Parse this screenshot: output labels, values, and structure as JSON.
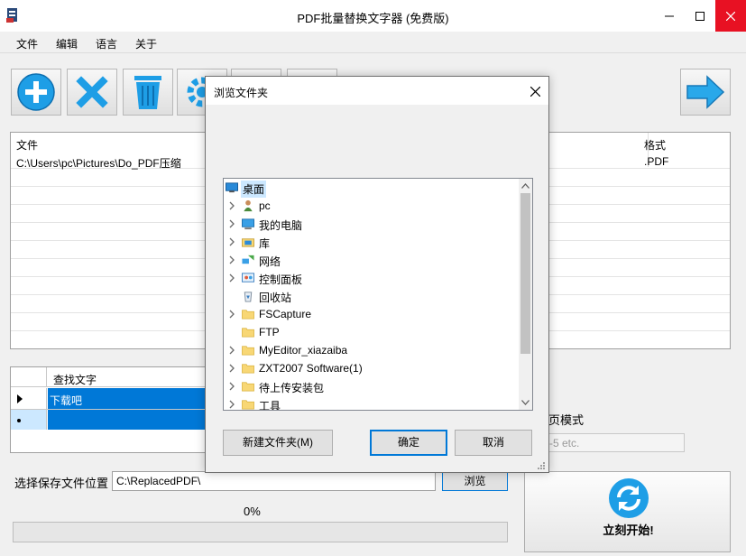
{
  "window": {
    "title": "PDF批量替换文字器 (免费版)"
  },
  "menu": [
    "文件",
    "编辑",
    "语言",
    "关于"
  ],
  "toolbar": {
    "buttons": [
      "add-icon",
      "remove-icon",
      "trash-icon",
      "settings-icon",
      "globe-icon",
      "info-icon",
      "next-arrow-icon"
    ]
  },
  "file_list": {
    "col_file": "文件",
    "col_format": "格式",
    "rows": [
      {
        "file": "C:\\Users\\pc\\Pictures\\Do_PDF压缩",
        "format": ".PDF"
      }
    ]
  },
  "grid": {
    "col_find": "查找文字",
    "rows": [
      {
        "value": "下载吧"
      },
      {
        "value": ""
      }
    ]
  },
  "right_panel": {
    "label": "页模式",
    "input_placeholder": "-5 etc."
  },
  "save": {
    "label": "选择保存文件位置",
    "path": "C:\\ReplacedPDF\\",
    "browse_label": "浏览"
  },
  "progress": {
    "text": "0%",
    "value": 0
  },
  "start_button": {
    "label": "立刻开始!"
  },
  "dialog": {
    "title": "浏览文件夹",
    "tree": [
      {
        "label": "桌面",
        "icon": "desktop-icon",
        "expandable": false,
        "selected": true,
        "level": 0
      },
      {
        "label": "pc",
        "icon": "user-icon",
        "expandable": true,
        "selected": false,
        "level": 1
      },
      {
        "label": "我的电脑",
        "icon": "computer-icon",
        "expandable": true,
        "selected": false,
        "level": 1
      },
      {
        "label": "库",
        "icon": "library-icon",
        "expandable": true,
        "selected": false,
        "level": 1
      },
      {
        "label": "网络",
        "icon": "network-icon",
        "expandable": true,
        "selected": false,
        "level": 1
      },
      {
        "label": "控制面板",
        "icon": "control-panel-icon",
        "expandable": true,
        "selected": false,
        "level": 1
      },
      {
        "label": "回收站",
        "icon": "recycle-bin-icon",
        "expandable": false,
        "selected": false,
        "level": 1
      },
      {
        "label": "FSCapture",
        "icon": "folder-icon",
        "expandable": true,
        "selected": false,
        "level": 1
      },
      {
        "label": "FTP",
        "icon": "folder-icon",
        "expandable": false,
        "selected": false,
        "level": 1
      },
      {
        "label": "MyEditor_xiazaiba",
        "icon": "folder-icon",
        "expandable": true,
        "selected": false,
        "level": 1
      },
      {
        "label": "ZXT2007 Software(1)",
        "icon": "folder-icon",
        "expandable": true,
        "selected": false,
        "level": 1
      },
      {
        "label": "待上传安装包",
        "icon": "folder-icon",
        "expandable": true,
        "selected": false,
        "level": 1
      },
      {
        "label": "工具",
        "icon": "folder-icon",
        "expandable": true,
        "selected": false,
        "level": 1
      }
    ],
    "new_folder_label": "新建文件夹(M)",
    "ok_label": "确定",
    "cancel_label": "取消"
  },
  "colors": {
    "accent": "#0078d7",
    "close_red": "#e81123",
    "folder_yellow": "#f8d775",
    "selection": "#cce8ff"
  }
}
